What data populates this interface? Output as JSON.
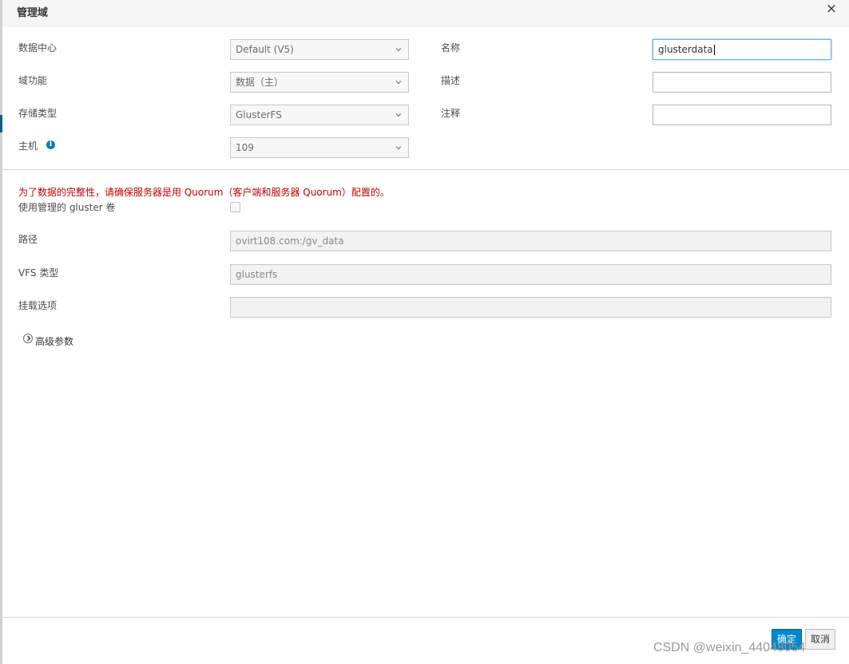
{
  "dialog": {
    "title": "管理域",
    "close_icon": "×"
  },
  "form": {
    "data_center": {
      "label": "数据中心",
      "value": "Default (V5)"
    },
    "domain_function": {
      "label": "域功能",
      "value": "数据（主）"
    },
    "storage_type": {
      "label": "存储类型",
      "value": "GlusterFS"
    },
    "host": {
      "label": "主机",
      "value": "109"
    },
    "name": {
      "label": "名称",
      "value": "glusterdata"
    },
    "description": {
      "label": "描述",
      "value": ""
    },
    "comment": {
      "label": "注释",
      "value": ""
    }
  },
  "gluster": {
    "warning": "为了数据的完整性，请确保服务器是用 Quorum（客户端和服务器 Quorum）配置的。",
    "use_managed_label": "使用管理的 gluster 卷",
    "path_label": "路径",
    "path_value": "ovirt108.com:/gv_data",
    "vfs_type_label": "VFS 类型",
    "vfs_type_value": "glusterfs",
    "mount_options_label": "挂载选项",
    "mount_options_value": ""
  },
  "advanced": {
    "label": "高级参数"
  },
  "footer": {
    "ok_label": "确定",
    "cancel_label": "取消"
  },
  "watermark": "CSDN @weixin_44048054",
  "colors": {
    "primary_button": "#0088ce",
    "warning_text": "#c00000",
    "info_icon": "#0b79b8"
  }
}
